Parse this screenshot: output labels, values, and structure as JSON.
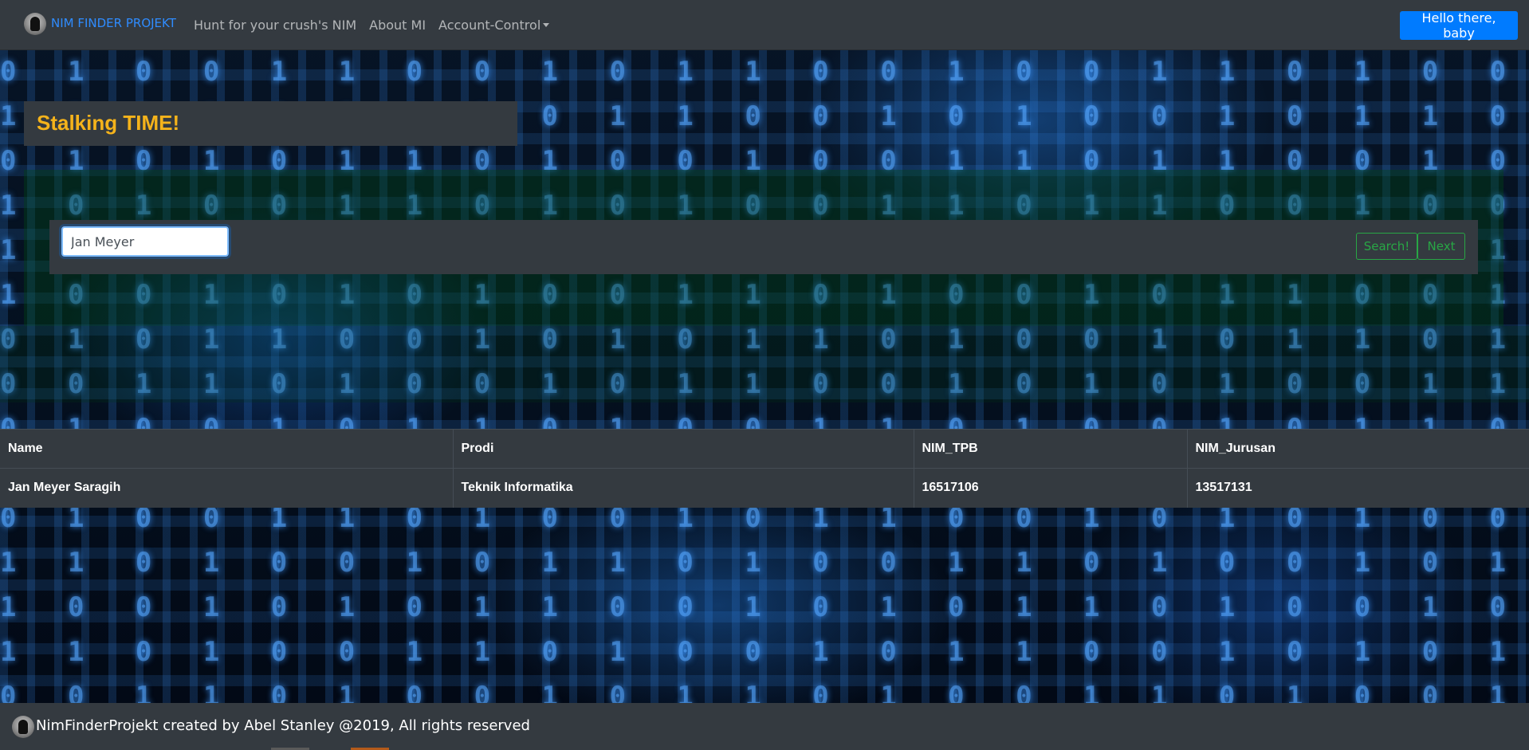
{
  "navbar": {
    "brand": "NIM FINDER PROJEKT",
    "links": [
      {
        "label": "Hunt for your crush's NIM"
      },
      {
        "label": "About MI"
      },
      {
        "label": "Account-Control"
      }
    ],
    "greeting_button": "Hello there, baby"
  },
  "hero": {
    "title": "Stalking TIME!"
  },
  "search": {
    "value": "Jan Meyer",
    "search_button": "Search!",
    "next_button": "Next"
  },
  "table": {
    "headers": [
      "Name",
      "Prodi",
      "NIM_TPB",
      "NIM_Jurusan"
    ],
    "rows": [
      [
        "Jan Meyer Saragih",
        "Teknik Informatika",
        "16517106",
        "13517131"
      ]
    ]
  },
  "footer": {
    "text": "NimFinderProjekt created by Abel Stanley @2019, All rights reserved"
  },
  "colors": {
    "navbar_bg": "#343a40",
    "brand": "#2f8cff",
    "title": "#f5b31b",
    "primary_button": "#007bff",
    "outline_success": "#28a745"
  },
  "icons": {
    "brand_logo": "hooded-figure-logo-icon",
    "dropdown": "caret-down-icon"
  }
}
